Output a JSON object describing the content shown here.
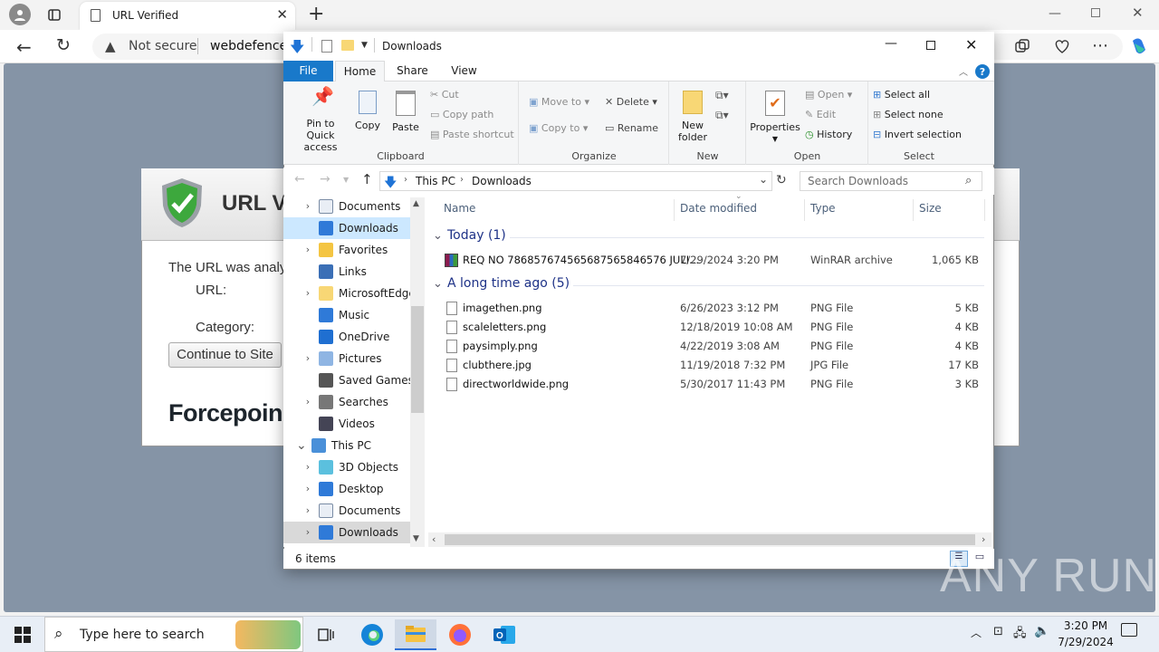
{
  "browser": {
    "tab_title": "URL Verified",
    "url_security": "Not secure",
    "url_text": "webdefence.g"
  },
  "page": {
    "card_title": "URL V",
    "line1": "The URL was analy",
    "line2": "URL:",
    "line3": "Category:",
    "continue_button": "Continue to Site",
    "brand": "Forcepoin"
  },
  "explorer": {
    "title": "Downloads",
    "tabs": [
      "File",
      "Home",
      "Share",
      "View"
    ],
    "ribbon": {
      "clipboard": {
        "pin": "Pin to Quick access",
        "copy": "Copy",
        "paste": "Paste",
        "cut": "Cut",
        "copy_path": "Copy path",
        "paste_shortcut": "Paste shortcut",
        "label": "Clipboard"
      },
      "organize": {
        "move_to": "Move to",
        "copy_to": "Copy to",
        "delete": "Delete",
        "rename": "Rename",
        "label": "Organize"
      },
      "new": {
        "new_folder": "New folder",
        "label": "New"
      },
      "open": {
        "properties": "Properties",
        "open": "Open",
        "edit": "Edit",
        "history": "History",
        "label": "Open"
      },
      "select": {
        "select_all": "Select all",
        "select_none": "Select none",
        "invert": "Invert selection",
        "label": "Select"
      }
    },
    "breadcrumb": [
      "This PC",
      "Downloads"
    ],
    "search_placeholder": "Search Downloads",
    "nav": [
      {
        "label": "Documents",
        "icon": "documents-icon",
        "chev": true
      },
      {
        "label": "Downloads",
        "icon": "downloads-icon",
        "chev": false,
        "selected": true
      },
      {
        "label": "Favorites",
        "icon": "star-icon",
        "chev": true
      },
      {
        "label": "Links",
        "icon": "links-icon",
        "chev": false
      },
      {
        "label": "MicrosoftEdge",
        "icon": "folder-icon",
        "chev": true
      },
      {
        "label": "Music",
        "icon": "music-icon",
        "chev": false
      },
      {
        "label": "OneDrive",
        "icon": "cloud-icon",
        "chev": false
      },
      {
        "label": "Pictures",
        "icon": "pictures-icon",
        "chev": true
      },
      {
        "label": "Saved Games",
        "icon": "games-icon",
        "chev": false
      },
      {
        "label": "Searches",
        "icon": "search-icon",
        "chev": true
      },
      {
        "label": "Videos",
        "icon": "videos-icon",
        "chev": false
      },
      {
        "label": "This PC",
        "icon": "pc-icon",
        "chev": true,
        "expanded": true
      },
      {
        "label": "3D Objects",
        "icon": "cube-icon",
        "chev": true,
        "indent": true
      },
      {
        "label": "Desktop",
        "icon": "desktop-icon",
        "chev": true,
        "indent": true
      },
      {
        "label": "Documents",
        "icon": "documents-icon",
        "chev": true,
        "indent": true
      },
      {
        "label": "Downloads",
        "icon": "downloads-icon",
        "chev": true,
        "indent": true,
        "selected_gray": true
      }
    ],
    "columns": [
      "Name",
      "Date modified",
      "Type",
      "Size"
    ],
    "groups": [
      {
        "label": "Today (1)",
        "files": [
          {
            "name": "REQ NO 786857674565687565846576 JULI...",
            "date": "7/29/2024 3:20 PM",
            "type": "WinRAR archive",
            "size": "1,065 KB",
            "icon": "rar-icon"
          }
        ]
      },
      {
        "label": "A long time ago (5)",
        "files": [
          {
            "name": "imagethen.png",
            "date": "6/26/2023 3:12 PM",
            "type": "PNG File",
            "size": "5 KB",
            "icon": "image-file-icon"
          },
          {
            "name": "scaleletters.png",
            "date": "12/18/2019 10:08 AM",
            "type": "PNG File",
            "size": "4 KB",
            "icon": "image-file-icon"
          },
          {
            "name": "paysimply.png",
            "date": "4/22/2019 3:08 AM",
            "type": "PNG File",
            "size": "4 KB",
            "icon": "image-file-icon"
          },
          {
            "name": "clubthere.jpg",
            "date": "11/19/2018 7:32 PM",
            "type": "JPG File",
            "size": "17 KB",
            "icon": "image-file-icon"
          },
          {
            "name": "directworldwide.png",
            "date": "5/30/2017 11:43 PM",
            "type": "PNG File",
            "size": "3 KB",
            "icon": "image-file-icon"
          }
        ]
      }
    ],
    "status": "6 items"
  },
  "taskbar": {
    "search_placeholder": "Type here to search",
    "time": "3:20 PM",
    "date": "7/29/2024"
  },
  "watermark": "ANY RUN"
}
